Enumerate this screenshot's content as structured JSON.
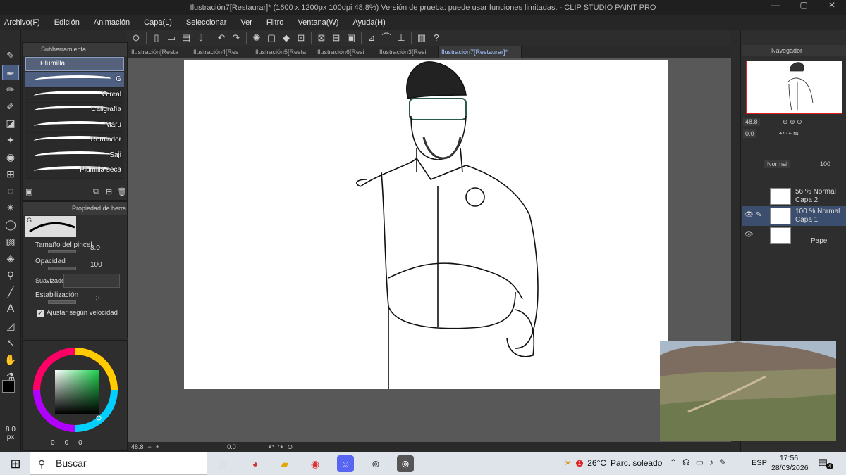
{
  "window": {
    "title": "Ilustración7[Restaurar]* (1600 x 1200px 100dpi 48.8%)  Versión de prueba: puede usar funciones limitadas. - CLIP STUDIO PAINT PRO",
    "minimize": "—",
    "maximize": "▢",
    "close": "✕"
  },
  "menu": [
    "Archivo(F)",
    "Edición",
    "Animación",
    "Capa(L)",
    "Seleccionar",
    "Ver",
    "Filtro",
    "Ventana(W)",
    "Ayuda(H)"
  ],
  "subtool": {
    "header": "Subherramienta",
    "group": "Plumilla",
    "brushes": [
      {
        "label": "G",
        "selected": true
      },
      {
        "label": "G real"
      },
      {
        "label": "Caligrafía"
      },
      {
        "label": "Maru"
      },
      {
        "label": "Rotulador"
      },
      {
        "label": "Saji"
      },
      {
        "label": "Plumilla seca"
      }
    ]
  },
  "properties": {
    "header": "Propiedad de herra",
    "preview_label": "G",
    "brush_size_label": "Tamaño del pincel",
    "brush_size_value": "8.0",
    "opacity_label": "Opacidad",
    "opacity_value": "100",
    "smoothing_label": "Suavizado",
    "stabilization_label": "Estabilización",
    "stabilization_value": "3",
    "adjust_speed_label": "Ajustar según velocidad"
  },
  "color": {
    "main_color": "#000000",
    "sub_color": "#ffffff",
    "brush_px_value": "8.0",
    "brush_px_unit": "px",
    "rgb_values": [
      "0",
      "0",
      "0"
    ]
  },
  "tabs": [
    {
      "label": "Ilustración[Resta"
    },
    {
      "label": "Ilustración4[Res"
    },
    {
      "label": "Ilustración5[Resta"
    },
    {
      "label": "Ilustración6[Resi"
    },
    {
      "label": "Ilustración3[Resi"
    },
    {
      "label": "Ilustración7[Restaurar]*",
      "active": true
    }
  ],
  "status": {
    "zoom": "48.8",
    "angle": "0.0"
  },
  "navigator": {
    "header": "Navegador",
    "zoom": "48.8",
    "angle": "0.0"
  },
  "layers_panel": {
    "blend_mode": "Normal",
    "opacity": "100",
    "layers": [
      {
        "mode": "56 % Normal",
        "name": "Capa 2"
      },
      {
        "mode": "100 % Normal",
        "name": "Capa 1",
        "selected": true
      },
      {
        "mode": "",
        "name": "Papel"
      }
    ]
  },
  "taskbar": {
    "search_placeholder": "Buscar",
    "weather_temp": "26°C",
    "weather_desc": "Parc. soleado",
    "weather_badge": "1",
    "language": "ESP",
    "time": "17:56",
    "date": "28/03/2026",
    "notifications": "4"
  }
}
